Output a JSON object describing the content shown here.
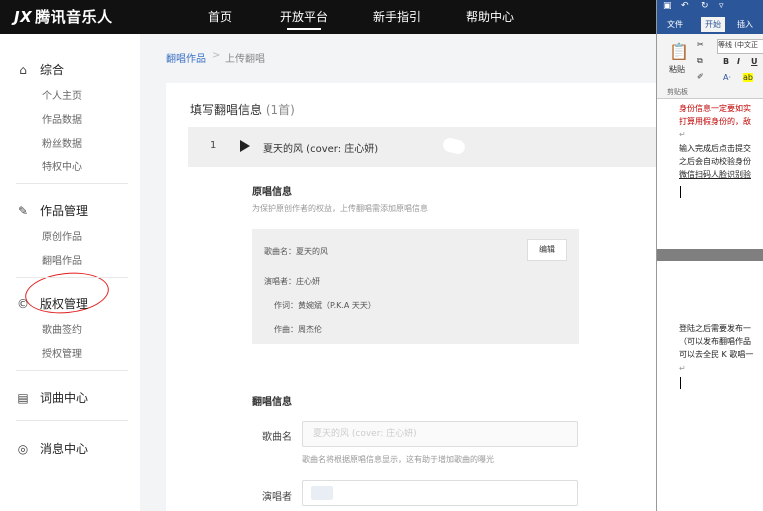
{
  "header": {
    "logo_mark": "JX",
    "logo_text": "腾讯音乐人",
    "nav": [
      "首页",
      "开放平台",
      "新手指引",
      "帮助中心"
    ]
  },
  "sidebar": {
    "sections": [
      {
        "label": "综合",
        "icon": "home-icon",
        "items": [
          "个人主页",
          "作品数据",
          "粉丝数据",
          "特权中心"
        ]
      },
      {
        "label": "作品管理",
        "icon": "edit-icon",
        "items": [
          "原创作品",
          "翻唱作品"
        ]
      },
      {
        "label": "版权管理",
        "icon": "copyright-icon",
        "items": [
          "歌曲签约",
          "授权管理"
        ]
      },
      {
        "label": "词曲中心",
        "icon": "lyrics-icon",
        "items": []
      },
      {
        "label": "消息中心",
        "icon": "message-icon",
        "items": []
      }
    ]
  },
  "breadcrumb": {
    "parent": "翻唱作品",
    "separator": ">",
    "current": "上传翻唱"
  },
  "form": {
    "title": "填写翻唱信息",
    "count": "(1首)",
    "song_row": {
      "index": "1",
      "name": "夏天的风 (cover: 庄心妍)"
    },
    "original": {
      "heading": "原唱信息",
      "hint": "为保护原创作者的权益，上传翻唱需添加原唱信息",
      "song": "歌曲名：夏天的风",
      "singer": "演唱者：庄心妍",
      "lyricist": "作词：黄婉斌（P.K.A 天天）",
      "composer": "作曲：周杰伦",
      "edit_label": "编辑"
    },
    "cover": {
      "heading": "翻唱信息",
      "song_label": "歌曲名",
      "song_placeholder": "夏天的风 (cover: 庄心妍)",
      "song_hint": "歌曲名将根据原唱信息显示，这有助于增加歌曲的曝光",
      "singer_label": "演唱者"
    }
  },
  "word": {
    "tabs": [
      "文件",
      "开始",
      "插入"
    ],
    "paste_label": "粘贴",
    "clipboard_label": "剪贴板",
    "font_name": "等线 (中文正",
    "doc_lines_red": [
      "身份信息一定要如实",
      "打算用假身份的，敌"
    ],
    "doc_lines_dark": [
      "输入完成后点击提交",
      "之后会自动校验身份",
      "微信扫码人脸识别验"
    ],
    "doc_lines_bottom": [
      "登陆之后需要发布一",
      "（可以发布翻唱作品",
      "可以去全民 K 歌唱一"
    ]
  }
}
